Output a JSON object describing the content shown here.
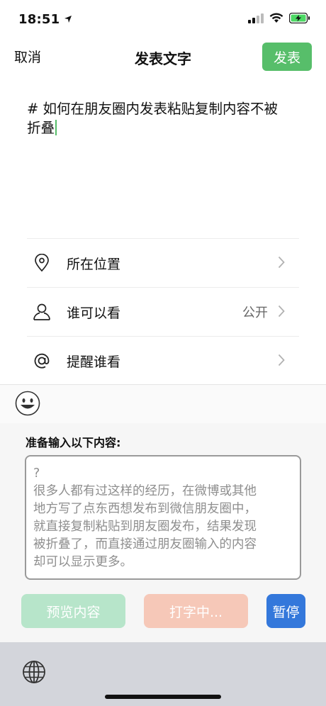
{
  "status_bar": {
    "time": "18:51",
    "icons": [
      "location-arrow-icon",
      "signal-icon",
      "wifi-icon",
      "battery-charging-icon"
    ]
  },
  "nav": {
    "cancel": "取消",
    "title": "发表文字",
    "publish": "发表"
  },
  "compose": {
    "line1": "# 如何在朋友圈内发表粘贴复制内容不被",
    "line2": "折叠"
  },
  "options": [
    {
      "icon": "location-pin-icon",
      "label": "所在位置",
      "value": ""
    },
    {
      "icon": "person-icon",
      "label": "谁可以看",
      "value": "公开"
    },
    {
      "icon": "at-sign-icon",
      "label": "提醒谁看",
      "value": ""
    }
  ],
  "panel": {
    "title": "准备输入以下内容:",
    "content_lines": [
      "?",
      "很多人都有过这样的经历，在微博或其他",
      "地方写了点东西想发布到微信朋友圈中，",
      "就直接复制粘贴到朋友圈发布，结果发现",
      "被折叠了，而直接通过朋友圈输入的内容",
      "却可以显示更多。"
    ],
    "buttons": {
      "preview": "预览内容",
      "typing": "打字中...",
      "pause": "暂停"
    }
  },
  "colors": {
    "accent_green": "#57be6a",
    "pause_blue": "#3478db"
  }
}
